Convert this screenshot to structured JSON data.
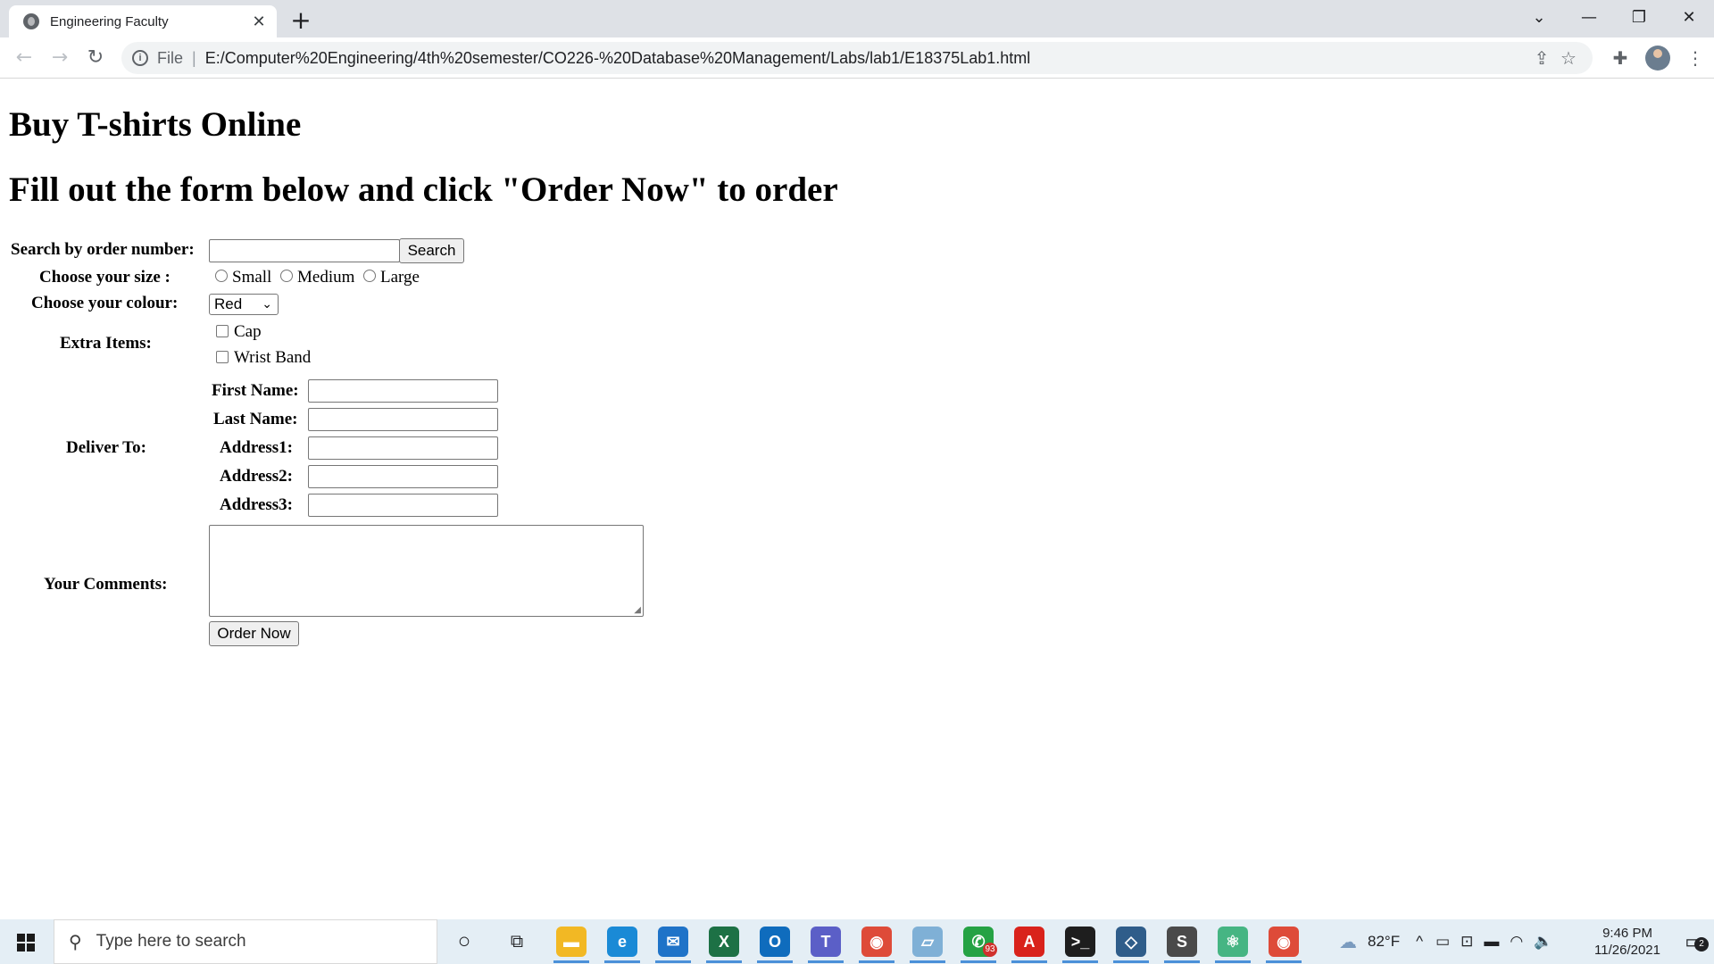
{
  "browser": {
    "tab_title": "Engineering Faculty",
    "tab_close": "✕",
    "new_tab": "+",
    "scheme": "File",
    "separator": "|",
    "url": "E:/Computer%20Engineering/4th%20semester/CO226-%20Database%20Management/Labs/lab1/E18375Lab1.html"
  },
  "page": {
    "heading1": "Buy T-shirts Online",
    "heading2": "Fill out the form below and click \"Order Now\" to order",
    "search_label": "Search by order number:",
    "search_value": "",
    "search_button": "Search",
    "size_label": "Choose your size :",
    "sizes": [
      "Small",
      "Medium",
      "Large"
    ],
    "colour_label": "Choose your colour:",
    "colour_selected": "Red",
    "extras_label": "Extra Items:",
    "extras": [
      "Cap",
      "Wrist Band"
    ],
    "deliver_label": "Deliver To:",
    "first_name_label": "First Name:",
    "last_name_label": "Last Name:",
    "address1_label": "Address1:",
    "address2_label": "Address2:",
    "address3_label": "Address3:",
    "comments_label": "Your Comments:",
    "order_button": "Order Now"
  },
  "taskbar": {
    "search_placeholder": "Type here to search",
    "temperature": "82°F",
    "time": "9:46 PM",
    "date": "11/26/2021",
    "whatsapp_badge": "93",
    "notifications": "2",
    "apps": [
      {
        "name": "file-explorer-icon",
        "color": "#f2b824"
      },
      {
        "name": "edge-icon",
        "color": "#1a8ad6"
      },
      {
        "name": "mail-icon",
        "color": "#1f73c8"
      },
      {
        "name": "excel-icon",
        "color": "#1d7145"
      },
      {
        "name": "outlook-icon",
        "color": "#0f6cbd"
      },
      {
        "name": "teams-icon",
        "color": "#5b5fc7"
      },
      {
        "name": "chrome-icon",
        "color": "#de4b39"
      },
      {
        "name": "notepad-icon",
        "color": "#7fb0d6"
      },
      {
        "name": "whatsapp-icon",
        "color": "#25a244"
      },
      {
        "name": "acrobat-icon",
        "color": "#d9221b"
      },
      {
        "name": "terminal-icon",
        "color": "#1e1e1e"
      },
      {
        "name": "virtualbox-icon",
        "color": "#2f5d8a"
      },
      {
        "name": "sublime-icon",
        "color": "#4a4a4a"
      },
      {
        "name": "atom-icon",
        "color": "#46b583"
      },
      {
        "name": "chrome-profile-icon",
        "color": "#de4b39"
      }
    ]
  }
}
